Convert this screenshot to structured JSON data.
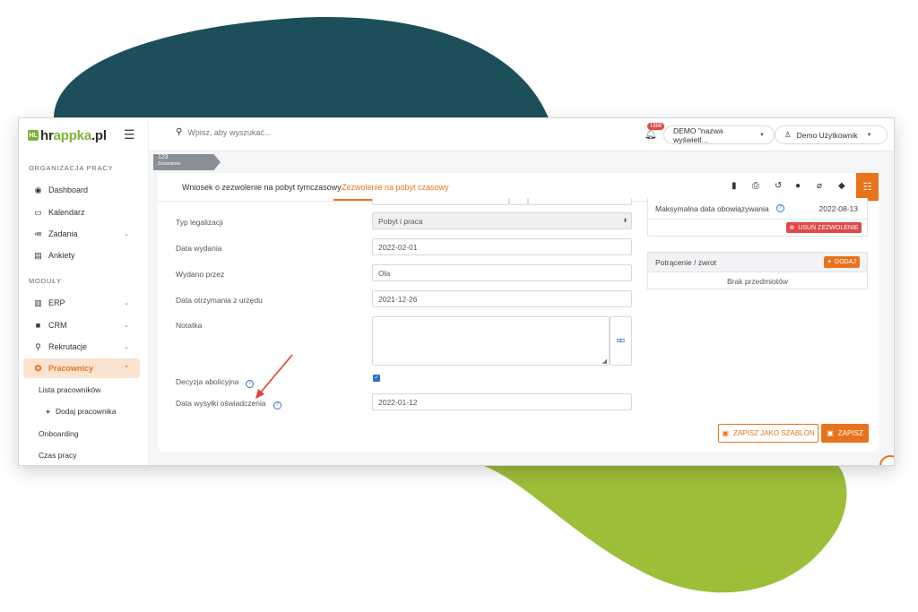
{
  "brand": {
    "logo_mark": "HL",
    "name_main": "hr",
    "name_accent": "appka",
    "name_tail": ".pl"
  },
  "colors": {
    "accent": "#e8731c",
    "brand_green": "#7db33a",
    "blob_teal": "#1d4f5a",
    "blob_green": "#9cbe39",
    "danger": "#e04848",
    "link_blue": "#3b74c9"
  },
  "sidebar": {
    "section_org": "ORGANIZACJA PRACY",
    "section_modules": "MODUŁY",
    "items": [
      {
        "label": "Dashboard",
        "icon": "palette-icon"
      },
      {
        "label": "Kalendarz",
        "icon": "calendar-icon"
      },
      {
        "label": "Zadania",
        "icon": "list-icon"
      },
      {
        "label": "Ankiety",
        "icon": "survey-icon"
      },
      {
        "label": "ERP",
        "icon": "building-icon"
      },
      {
        "label": "CRM",
        "icon": "briefcase-icon"
      },
      {
        "label": "Rekrutacje",
        "icon": "search-icon"
      },
      {
        "label": "Pracownicy",
        "icon": "users-icon"
      }
    ],
    "sub_items": [
      "Lista pracowników",
      "Dodaj pracownika",
      "Onboarding",
      "Czas pracy"
    ]
  },
  "topbar": {
    "search_placeholder": "Wpisz, aby wyszukać...",
    "notification_count": "1886",
    "company_selector": "DEMO \"nazwa wyświetl...",
    "user_menu": "Demo Użytkownik"
  },
  "breadcrumb": {
    "number": "123",
    "label": "Zezwolenie"
  },
  "tabs": [
    "Wniosek o zezwolenie na pobyt tymczasowy",
    "Zezwolenie na pobyt czasowy"
  ],
  "toolbar_icons": [
    "document-icon",
    "print-icon",
    "history-icon",
    "comments-icon",
    "attachment-icon",
    "tag-icon",
    "checklist-icon"
  ],
  "form": {
    "typ_legalizacji": {
      "label": "Typ legalizacji",
      "value": "Pobyt i praca"
    },
    "data_wydania": {
      "label": "Data wydania",
      "value": "2022-02-01"
    },
    "wydano_przez": {
      "label": "Wydano przez",
      "value": "Ola"
    },
    "data_otrzymania": {
      "label": "Data otrzymania z urzędu",
      "value": "2021-12-26"
    },
    "notatka": {
      "label": "Notatka",
      "value": ""
    },
    "decyzja": {
      "label": "Decyzja abolicyjna",
      "checked": true
    },
    "data_wysylki": {
      "label": "Data wysyłki oświadczenia",
      "value": "2022-01-12"
    }
  },
  "right_panel": {
    "max_date_label": "Maksymalna data obowiązywania",
    "max_date_value": "2022-08-13",
    "delete_button": "USUŃ ZEZWOLENIE",
    "deductions_title": "Potrącenie / zwrot",
    "add_button": "DODAJ",
    "empty_text": "Brak przedmiotów"
  },
  "actions": {
    "save_template": "ZAPISZ JAKO SZABLON",
    "save": "ZAPISZ"
  }
}
